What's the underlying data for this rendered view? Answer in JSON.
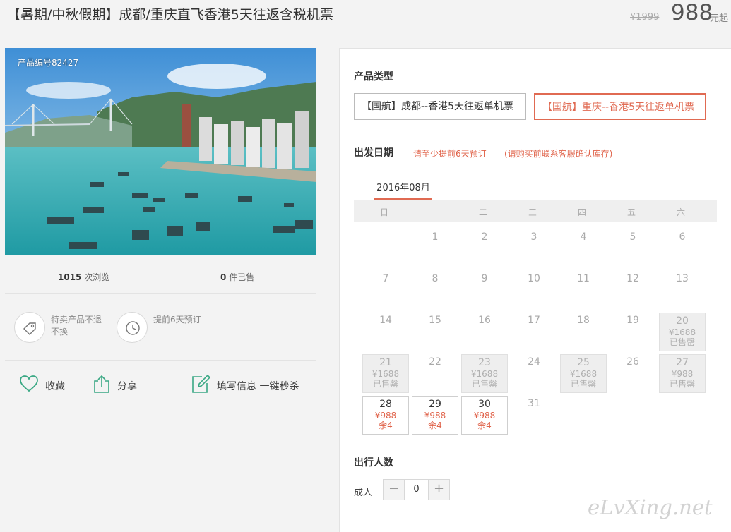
{
  "header": {
    "title": "【暑期/中秋假期】成都/重庆直飞香港5天往返含税机票",
    "original_price": "¥1999",
    "price": "988",
    "price_unit": "元起"
  },
  "gallery": {
    "product_id": "产品编号82427"
  },
  "stats": {
    "views_count": "1015",
    "views_label": "次浏览",
    "sold_count": "0",
    "sold_label": "件已售"
  },
  "features": [
    {
      "icon": "tag-icon",
      "text": "特卖产品不退不换"
    },
    {
      "icon": "clock-icon",
      "text": "提前6天预订"
    }
  ],
  "actions": {
    "favorite": "收藏",
    "share": "分享",
    "fill_info": "填写信息 一键秒杀"
  },
  "booking": {
    "product_type_label": "产品类型",
    "product_types": [
      {
        "label": "【国航】成都--香港5天往返单机票",
        "selected": false
      },
      {
        "label": "【国航】重庆--香港5天往返单机票",
        "selected": true
      }
    ],
    "departure_label": "出发日期",
    "note_advance": "请至少提前6天预订",
    "note_confirm": "(请购买前联系客服确认库存)",
    "month": "2016年08月",
    "weekdays": [
      "日",
      "一",
      "二",
      "三",
      "四",
      "五",
      "六"
    ],
    "start_offset": 1,
    "days": [
      {
        "day": "1"
      },
      {
        "day": "2"
      },
      {
        "day": "3"
      },
      {
        "day": "4"
      },
      {
        "day": "5"
      },
      {
        "day": "6"
      },
      {
        "day": "7"
      },
      {
        "day": "8"
      },
      {
        "day": "9"
      },
      {
        "day": "10"
      },
      {
        "day": "11"
      },
      {
        "day": "12"
      },
      {
        "day": "13"
      },
      {
        "day": "14"
      },
      {
        "day": "15"
      },
      {
        "day": "16"
      },
      {
        "day": "17"
      },
      {
        "day": "18"
      },
      {
        "day": "19"
      },
      {
        "day": "20",
        "price": "¥1688",
        "status": "已售罄"
      },
      {
        "day": "21",
        "price": "¥1688",
        "status": "已售罄"
      },
      {
        "day": "22"
      },
      {
        "day": "23",
        "price": "¥1688",
        "status": "已售罄"
      },
      {
        "day": "24"
      },
      {
        "day": "25",
        "price": "¥1688",
        "status": "已售罄"
      },
      {
        "day": "26"
      },
      {
        "day": "27",
        "price": "¥988",
        "status": "已售罄"
      },
      {
        "day": "28",
        "price": "¥988",
        "status": "余4"
      },
      {
        "day": "29",
        "price": "¥988",
        "status": "余4"
      },
      {
        "day": "30",
        "price": "¥988",
        "status": "余4"
      },
      {
        "day": "31"
      }
    ],
    "persons_label": "出行人数",
    "adult_label": "成人",
    "adult_count": "0",
    "minus_symbol": "−",
    "plus_symbol": "+"
  },
  "watermark": "eLvXing.net",
  "colors": {
    "accent": "#e06a52",
    "icon_green": "#3aa884"
  }
}
